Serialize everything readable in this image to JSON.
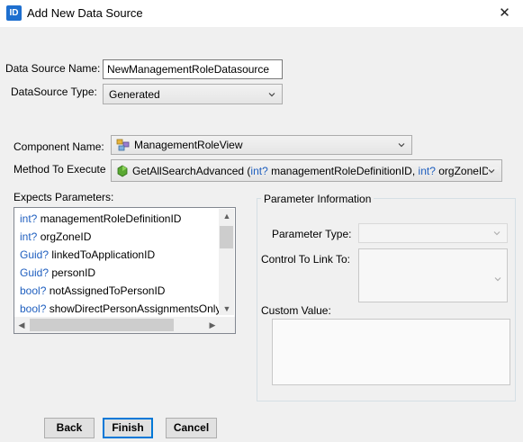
{
  "window": {
    "icon_text": "ID",
    "title": "Add New Data Source",
    "close_glyph": "✕"
  },
  "form": {
    "datasource_name_label": "Data Source Name:",
    "datasource_name_value": "NewManagementRoleDatasource",
    "datasource_type_label": "DataSource Type:",
    "datasource_type_value": "Generated",
    "component_name_label": "Component Name:",
    "component_name_value": "ManagementRoleView",
    "method_label": "Method To Execute",
    "method_value": {
      "name": "GetAllSearchAdvanced (",
      "p1_type": "int?",
      "p1_name": " managementRoleDefinitionID, ",
      "p2_type": "int?",
      "p2_name": " orgZoneID"
    }
  },
  "parameters": {
    "label": "Expects Parameters:",
    "items": [
      {
        "type": "int?",
        "name": "managementRoleDefinitionID"
      },
      {
        "type": "int?",
        "name": "orgZoneID"
      },
      {
        "type": "Guid?",
        "name": "linkedToApplicationID"
      },
      {
        "type": "Guid?",
        "name": "personID"
      },
      {
        "type": "bool?",
        "name": "notAssignedToPersonID"
      },
      {
        "type": "bool?",
        "name": "showDirectPersonAssignmentsOnly"
      }
    ]
  },
  "param_info": {
    "title": "Parameter Information",
    "type_label": "Parameter Type:",
    "control_label": "Control To Link To:",
    "custom_label": "Custom Value:"
  },
  "buttons": {
    "back": "Back",
    "finish": "Finish",
    "cancel": "Cancel"
  },
  "icons": {
    "app": "app-icon",
    "component": "component-icon",
    "method": "method-icon",
    "dropdown": "chevron-down-icon"
  }
}
